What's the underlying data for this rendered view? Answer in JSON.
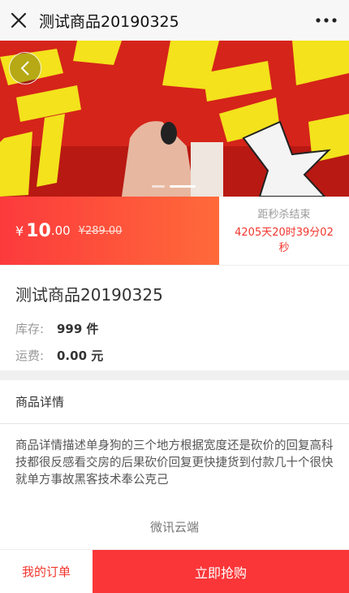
{
  "header": {
    "title": "测试商品20190325",
    "close_icon": "close-icon",
    "more_icon": "more-dots-icon"
  },
  "banner": {
    "slide_count": 2,
    "active_slide": 2,
    "back_icon": "chevron-left-icon"
  },
  "price": {
    "currency": "¥",
    "sale_int": "10",
    "sale_dec": ".00",
    "original": "¥289.00"
  },
  "countdown": {
    "label": "距秒杀结束",
    "value": "4205天20时39分02秒"
  },
  "product": {
    "name": "测试商品20190325",
    "stock_label": "库存:",
    "stock_value": "999 件",
    "shipping_label": "运费:",
    "shipping_value": "0.00 元"
  },
  "detail": {
    "heading": "商品详情",
    "text": "商品详情描述单身狗的三个地方根据宽度还是砍价的回复高科技都很反感看交房的后果砍价回复更快捷货到付款几十个很快就单方事故黑客技术奉公克己"
  },
  "footer": {
    "brand": "微讯云端"
  },
  "actions": {
    "my_orders": "我的订单",
    "buy_now": "立即抢购"
  },
  "colors": {
    "accent": "#fb3638",
    "price_gradient_end": "#ff6a3a",
    "countdown": "#f2362d"
  }
}
